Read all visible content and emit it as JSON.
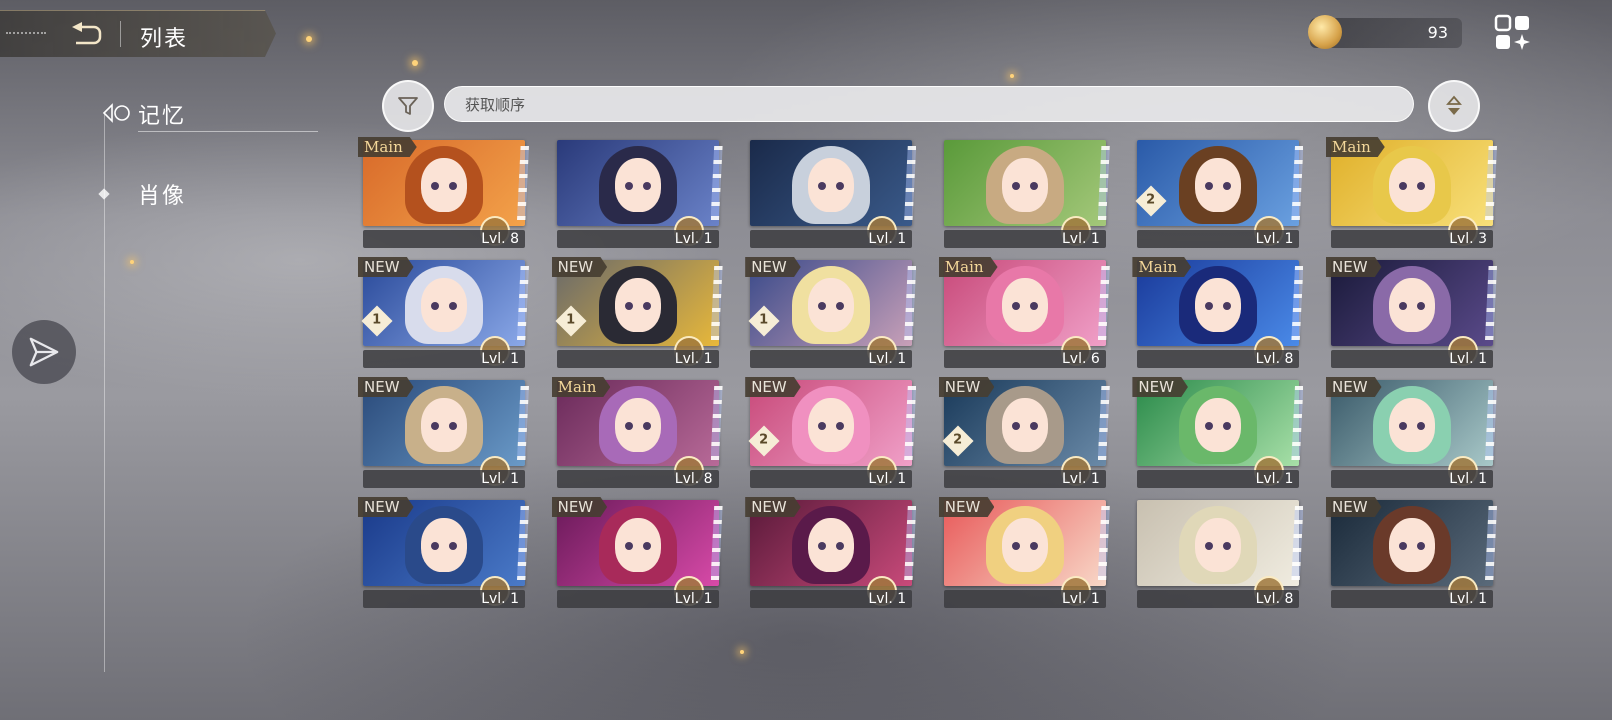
{
  "header": {
    "title": "列表"
  },
  "currency": {
    "icon": "coin-icon",
    "value": "93"
  },
  "sidebar": {
    "items": [
      {
        "label": "记忆",
        "active": true
      },
      {
        "label": "肖像",
        "active": false
      }
    ]
  },
  "sort": {
    "label": "获取顺序"
  },
  "cards": [
    {
      "tag": "Main",
      "level": "Lvl. 8",
      "num": "",
      "bg": [
        "#d86a2a",
        "#f3a24a"
      ],
      "hair": "#b4511e"
    },
    {
      "tag": "",
      "level": "Lvl. 1",
      "num": "",
      "bg": [
        "#2a3a7a",
        "#6a82c8"
      ],
      "hair": "#2a2a4a"
    },
    {
      "tag": "",
      "level": "Lvl. 1",
      "num": "",
      "bg": [
        "#1a2a4a",
        "#3a5a8a"
      ],
      "hair": "#c8d0dc"
    },
    {
      "tag": "",
      "level": "Lvl. 1",
      "num": "",
      "bg": [
        "#5a9a3a",
        "#a4c87a"
      ],
      "hair": "#c8aa82"
    },
    {
      "tag": "",
      "level": "Lvl. 1",
      "num": "2",
      "bg": [
        "#2a5aa8",
        "#6aa0e0"
      ],
      "hair": "#6a4022"
    },
    {
      "tag": "Main",
      "level": "Lvl. 3",
      "num": "",
      "bg": [
        "#e0b02a",
        "#f8e07a"
      ],
      "hair": "#e8c84a"
    },
    {
      "tag": "NEW",
      "level": "Lvl. 1",
      "num": "1",
      "bg": [
        "#2a4a9a",
        "#8aa8e8"
      ],
      "hair": "#d8dcec"
    },
    {
      "tag": "NEW",
      "level": "Lvl. 1",
      "num": "1",
      "bg": [
        "#6a6a6a",
        "#e8b83a"
      ],
      "hair": "#2a2a34"
    },
    {
      "tag": "NEW",
      "level": "Lvl. 1",
      "num": "1",
      "bg": [
        "#3a4a8a",
        "#c8a0b8"
      ],
      "hair": "#f0e0a0"
    },
    {
      "tag": "Main",
      "level": "Lvl. 6",
      "num": "",
      "bg": [
        "#c84a7a",
        "#f0a0c8"
      ],
      "hair": "#e878a8"
    },
    {
      "tag": "Main",
      "level": "Lvl. 8",
      "num": "",
      "bg": [
        "#1a3a9a",
        "#4a8ae8"
      ],
      "hair": "#1a2a7a"
    },
    {
      "tag": "NEW",
      "level": "Lvl. 1",
      "num": "",
      "bg": [
        "#1a1a3a",
        "#5a4a8a"
      ],
      "hair": "#8a6aa8"
    },
    {
      "tag": "NEW",
      "level": "Lvl. 1",
      "num": "",
      "bg": [
        "#2a4a7a",
        "#6a9ac8"
      ],
      "hair": "#c8b08a"
    },
    {
      "tag": "Main",
      "level": "Lvl. 8",
      "num": "",
      "bg": [
        "#6a2a5a",
        "#b86a98"
      ],
      "hair": "#a86ab8"
    },
    {
      "tag": "NEW",
      "level": "Lvl. 1",
      "num": "2",
      "bg": [
        "#c84a7a",
        "#f0a0c8"
      ],
      "hair": "#f090c0"
    },
    {
      "tag": "NEW",
      "level": "Lvl. 1",
      "num": "2",
      "bg": [
        "#1a3a5a",
        "#6a8aa8"
      ],
      "hair": "#a89a8a"
    },
    {
      "tag": "NEW",
      "level": "Lvl. 1",
      "num": "",
      "bg": [
        "#2a8a4a",
        "#a8e0a8"
      ],
      "hair": "#6ab86a"
    },
    {
      "tag": "NEW",
      "level": "Lvl. 1",
      "num": "",
      "bg": [
        "#3a5a6a",
        "#a8c8c8"
      ],
      "hair": "#8ad0b0"
    },
    {
      "tag": "NEW",
      "level": "Lvl. 1",
      "num": "",
      "bg": [
        "#1a3a8a",
        "#4a7ac8"
      ],
      "hair": "#2a4a8a"
    },
    {
      "tag": "NEW",
      "level": "Lvl. 1",
      "num": "",
      "bg": [
        "#6a1a5a",
        "#d84aa8"
      ],
      "hair": "#a82a5a"
    },
    {
      "tag": "NEW",
      "level": "Lvl. 1",
      "num": "",
      "bg": [
        "#5a1a3a",
        "#c84a7a"
      ],
      "hair": "#5a1a4a"
    },
    {
      "tag": "NEW",
      "level": "Lvl. 1",
      "num": "",
      "bg": [
        "#e85a5a",
        "#f8d8c8"
      ],
      "hair": "#f0d080"
    },
    {
      "tag": "",
      "level": "Lvl. 8",
      "num": "",
      "bg": [
        "#c8c0b0",
        "#f0ece0"
      ],
      "hair": "#e0d8b8"
    },
    {
      "tag": "NEW",
      "level": "Lvl. 1",
      "num": "",
      "bg": [
        "#1a2a3a",
        "#5a6a7a"
      ],
      "hair": "#6a3a2a"
    }
  ]
}
